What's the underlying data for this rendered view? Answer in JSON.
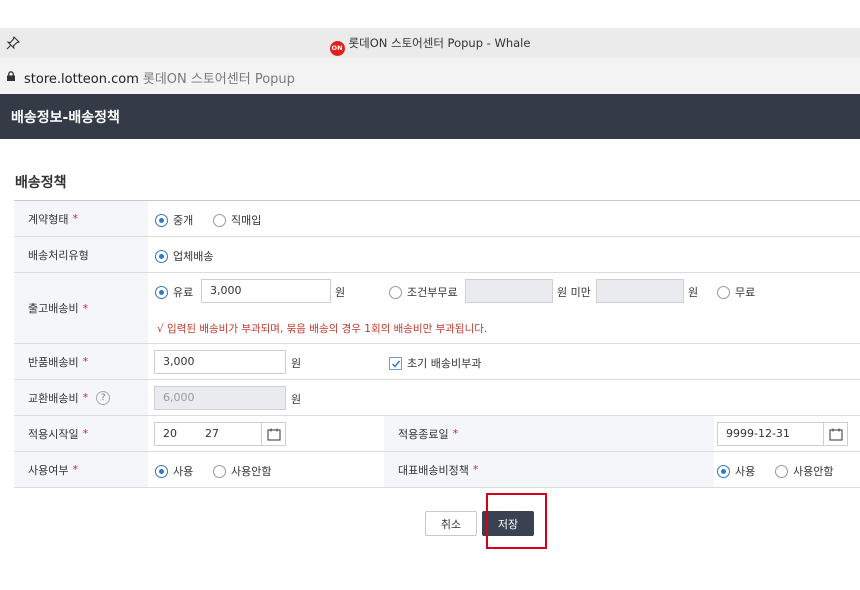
{
  "browser": {
    "window_title": "롯데ON 스토어센터 Popup - Whale",
    "logo_text": "ON",
    "url_host": "store.lotteon.com",
    "url_title": "롯데ON 스토어센터 Popup"
  },
  "header": {
    "title": "배송정보-배송정책"
  },
  "section": {
    "title": "배송정책"
  },
  "form": {
    "contract_type": {
      "label": "계약형태",
      "options": [
        "중개",
        "직매입"
      ],
      "selected": "중개"
    },
    "processing_type": {
      "label": "배송처리유형",
      "options": [
        "업체배송"
      ],
      "selected": "업체배송"
    },
    "outbound_fee": {
      "label": "출고배송비",
      "options": [
        "유료",
        "조건부무료",
        "무료"
      ],
      "selected": "유료",
      "paid_value": "3,000",
      "unit": "원",
      "conditional_unit_suffix": "원 미만",
      "conditional_unit": "원",
      "warning": "√  입력된 배송비가 부과되며, 묶음 배송의 경우 1회의 배송비만 부과됩니다."
    },
    "return_fee": {
      "label": "반품배송비",
      "value": "3,000",
      "unit": "원",
      "initial_fee_checkbox": "초기 배송비부과",
      "initial_fee_checked": true
    },
    "exchange_fee": {
      "label": "교환배송비",
      "help": "?",
      "value": "6,000",
      "unit": "원"
    },
    "start_date": {
      "label": "적용시작일",
      "value_prefix": "20",
      "value_suffix": "27"
    },
    "end_date": {
      "label": "적용종료일",
      "value": "9999-12-31"
    },
    "usage": {
      "label": "사용여부",
      "options": [
        "사용",
        "사용안함"
      ],
      "selected": "사용"
    },
    "representative": {
      "label": "대표배송비정책",
      "options": [
        "사용",
        "사용안함"
      ],
      "selected": "사용"
    },
    "required_mark": "*"
  },
  "buttons": {
    "cancel": "취소",
    "save": "저장"
  },
  "colors": {
    "header_bg": "#343a46",
    "accent": "#2f78c4",
    "required": "#e02020",
    "highlight": "#d6001c"
  }
}
